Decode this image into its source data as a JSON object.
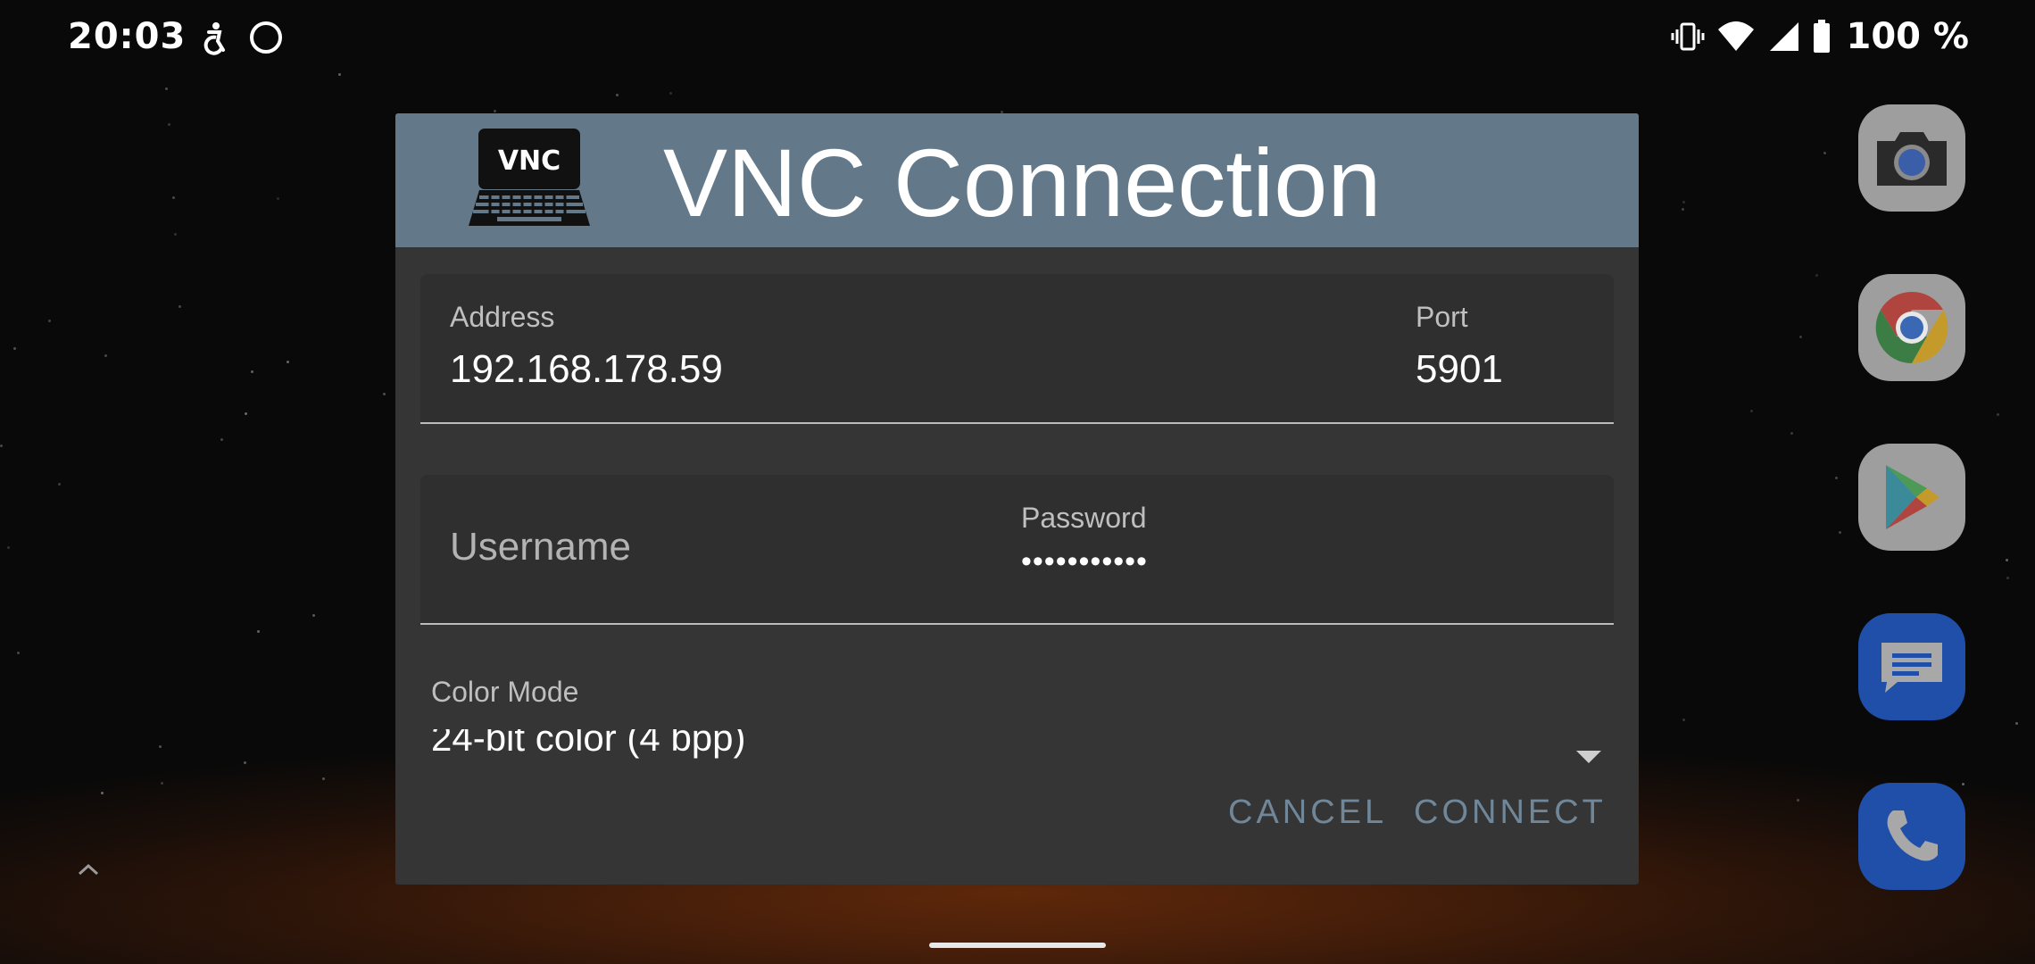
{
  "status_bar": {
    "time": "20:03",
    "left_icons": [
      "accessibility-icon",
      "circle-icon"
    ],
    "right_icons": [
      "vibrate-icon",
      "wifi-icon",
      "cellular-signal-icon",
      "battery-icon"
    ],
    "battery": "100 %"
  },
  "dialog": {
    "title": "VNC Connection",
    "logo_text": "VNC",
    "address": {
      "label": "Address",
      "value": "192.168.178.59"
    },
    "port": {
      "label": "Port",
      "value": "5901"
    },
    "username": {
      "placeholder": "Username",
      "value": ""
    },
    "password": {
      "label": "Password",
      "value": "•••••••••••"
    },
    "color_mode": {
      "label": "Color Mode",
      "value": "24-bit color (4 bpp)"
    },
    "buttons": {
      "cancel": "CANCEL",
      "connect": "CONNECT"
    }
  },
  "dock": [
    "camera-icon",
    "chrome-icon",
    "play-store-icon",
    "messages-icon",
    "phone-icon"
  ],
  "colors": {
    "header": "#63798a",
    "dialog_bg": "#353535",
    "button_text": "#6f8799",
    "dock_blue": "#1f4fa8"
  }
}
